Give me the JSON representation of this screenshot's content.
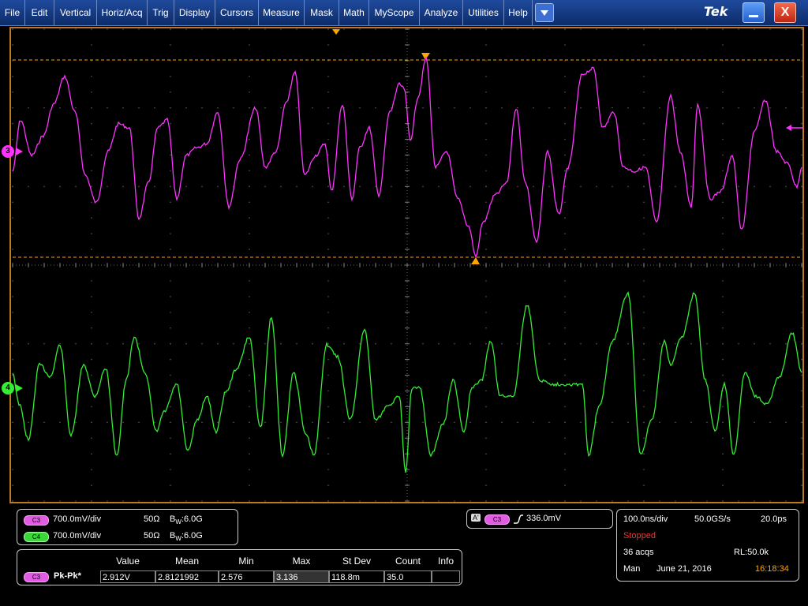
{
  "menu": {
    "items": [
      "File",
      "Edit",
      "Vertical",
      "Horiz/Acq",
      "Trig",
      "Display",
      "Cursors",
      "Measure",
      "Mask",
      "Math",
      "MyScope",
      "Analyze",
      "Utilities",
      "Help"
    ],
    "logo": "Tek",
    "close_glyph": "X"
  },
  "icons": {
    "dropdown": "chevron-down-icon",
    "minimize": "minimize-icon",
    "close": "close-icon",
    "trigger_edge": "rising-edge-icon"
  },
  "colors": {
    "ch3": "#ff33ff",
    "ch4": "#33ee33",
    "cursor": "#ffa500",
    "stopped": "#ff3030",
    "time": "#ffa500"
  },
  "channels": {
    "ch3_marker": "3",
    "ch4_marker": "4",
    "ch3": {
      "badge": "C3",
      "scale": "700.0mV/div",
      "imp": "50Ω",
      "bw_b": "B",
      "bw_w": "W",
      "bw": ":6.0G"
    },
    "ch4": {
      "badge": "C4",
      "scale": "700.0mV/div",
      "imp": "50Ω",
      "bw_b": "B",
      "bw_w": "W",
      "bw": ":6.0G"
    }
  },
  "measure": {
    "headers": [
      "Value",
      "Mean",
      "Min",
      "Max",
      "St Dev",
      "Count",
      "Info"
    ],
    "row": {
      "badge": "C3",
      "name": "Pk-Pk*",
      "value": "2.912V",
      "mean": "2.8121992",
      "min": "2.576",
      "max": "3.136",
      "stdev": "118.8m",
      "count": "35.0",
      "info": ""
    }
  },
  "trigger": {
    "type": "A'",
    "source": "C3",
    "level": "336.0mV"
  },
  "acquisition": {
    "timebase": "100.0ns/div",
    "sample_rate": "50.0GS/s",
    "resolution": "20.0ps",
    "state": "Stopped",
    "acqs": "36 acqs",
    "record_length": "RL:50.0k",
    "mode": "Man",
    "date": "June 21, 2016",
    "time": "16:18:34"
  }
}
